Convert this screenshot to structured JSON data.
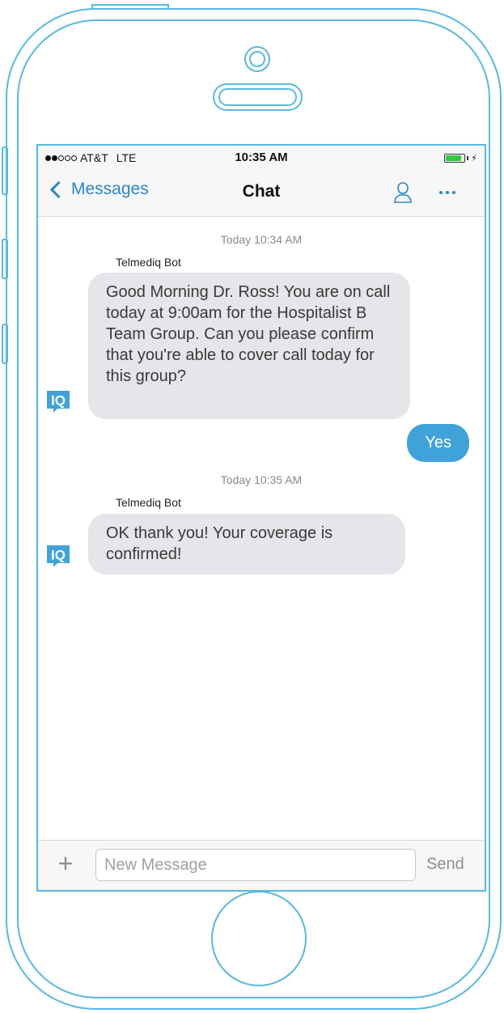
{
  "status_bar": {
    "carrier": "AT&T",
    "network": "LTE",
    "time": "10:35 AM"
  },
  "nav": {
    "back_label": "Messages",
    "title": "Chat"
  },
  "conversation": [
    {
      "timestamp": "Today 10:34 AM",
      "sender": "Telmediq Bot",
      "incoming_text": "Good Morning Dr. Ross!  You are on call today at 9:00am for the Hospitalist B Team Group.  Can you please confirm that you're able to cover call today for this group?",
      "reply_text": "Yes"
    },
    {
      "timestamp": "Today 10:35 AM",
      "sender": "Telmediq Bot",
      "incoming_text": "OK thank you!  Your coverage is confirmed!"
    }
  ],
  "avatar_label": "IQ",
  "composer": {
    "placeholder": "New Message",
    "value": "",
    "send_label": "Send"
  },
  "colors": {
    "accent": "#2a86c7",
    "outgoing_bubble": "#3fa3d9",
    "incoming_bubble": "#e5e5ea",
    "phone_outline": "#57b9df"
  },
  "icons": {
    "back": "chevron-left-icon",
    "contact": "person-icon",
    "more": "more-dots-icon",
    "add": "plus-icon",
    "avatar": "telmediq-iq-logo-icon"
  }
}
